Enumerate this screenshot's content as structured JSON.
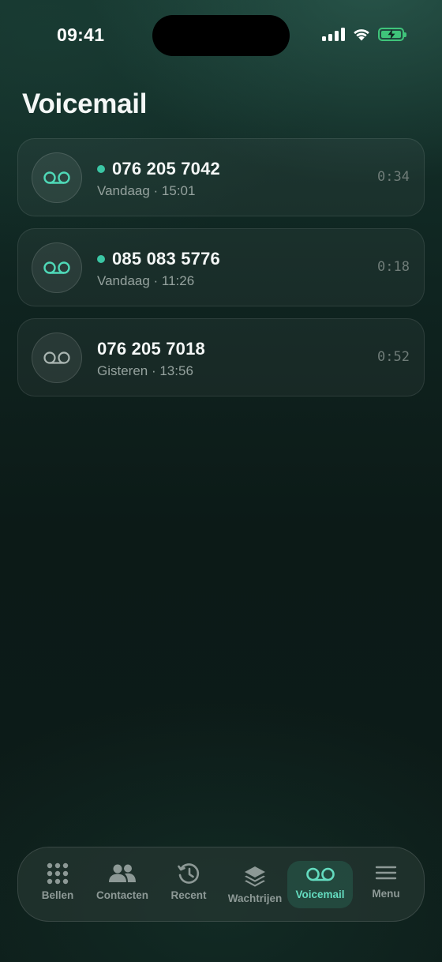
{
  "status_bar": {
    "time": "09:41"
  },
  "header": {
    "title": "Voicemail"
  },
  "voicemails": [
    {
      "number": "076 205 7042",
      "date": "Vandaag",
      "time": "15:01",
      "meta": "Vandaag · 15:01",
      "duration": "0:34",
      "unread": true
    },
    {
      "number": "085 083 5776",
      "date": "Vandaag",
      "time": "11:26",
      "meta": "Vandaag · 11:26",
      "duration": "0:18",
      "unread": true
    },
    {
      "number": "076 205 7018",
      "date": "Gisteren",
      "time": "13:56",
      "meta": "Gisteren · 13:56",
      "duration": "0:52",
      "unread": false
    }
  ],
  "tabbar": {
    "active": "voicemail",
    "tabs": [
      {
        "id": "bellen",
        "label": "Bellen",
        "icon": "keypad-icon"
      },
      {
        "id": "contacten",
        "label": "Contacten",
        "icon": "contacts-icon"
      },
      {
        "id": "recent",
        "label": "Recent",
        "icon": "history-icon"
      },
      {
        "id": "wachtrijen",
        "label": "Wachtrijen",
        "icon": "layers-icon"
      },
      {
        "id": "voicemail",
        "label": "Voicemail",
        "icon": "voicemail-icon"
      },
      {
        "id": "menu",
        "label": "Menu",
        "icon": "menu-icon"
      }
    ]
  },
  "colors": {
    "accent": "#3bc6a4",
    "background": "#0c1a17",
    "battery": "#3fc47a"
  }
}
